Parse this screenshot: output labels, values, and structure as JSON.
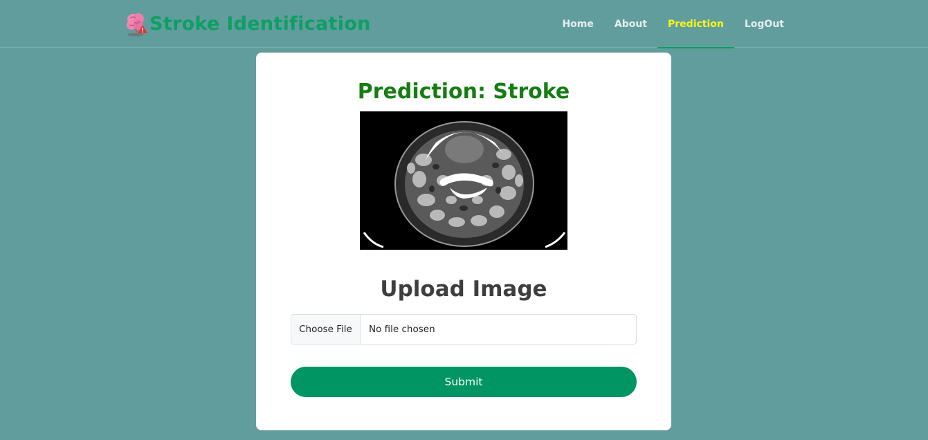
{
  "brand": {
    "title": "Stroke Identification",
    "logo_icon": "brain-warning-icon"
  },
  "nav": {
    "items": [
      {
        "label": "Home",
        "active": false
      },
      {
        "label": "About",
        "active": false
      },
      {
        "label": "Prediction",
        "active": true
      },
      {
        "label": "LogOut",
        "active": false
      }
    ]
  },
  "result": {
    "prediction": "Prediction: Stroke"
  },
  "upload": {
    "heading": "Upload Image",
    "choose_label": "Choose File",
    "status": "No file chosen",
    "submit_label": "Submit"
  },
  "colors": {
    "background": "#629d9e",
    "brand": "#0d9f63",
    "active_nav": "#f7f71d",
    "prediction": "#157d12",
    "submit": "#009562"
  }
}
